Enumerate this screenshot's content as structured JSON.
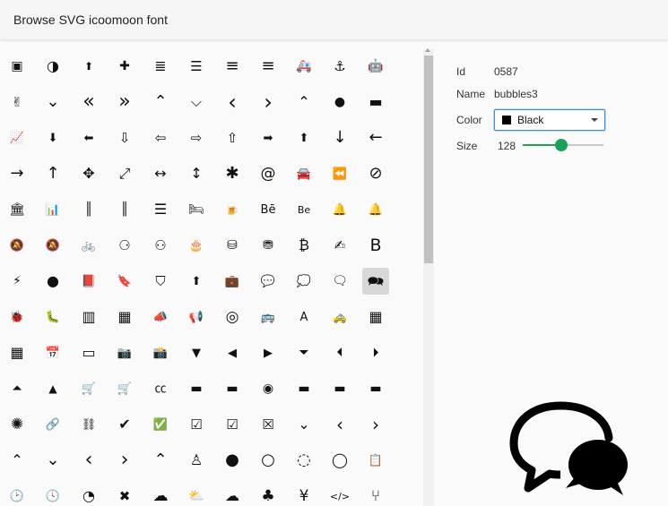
{
  "app": {
    "title": "Browse SVG icoomoon font"
  },
  "details": {
    "id_label": "Id",
    "id_value": "0587",
    "name_label": "Name",
    "name_value": "bubbles3",
    "color_label": "Color",
    "color_value": "Black",
    "color_hex": "#000000",
    "size_label": "Size",
    "size_value": "128",
    "size_fraction": 0.48
  },
  "icons": [
    [
      "address-book",
      "contrast",
      "arrow-up-circle",
      "first-aid",
      "align-center",
      "align-justify",
      "align-left",
      "align-right",
      "ambulance",
      "anchor",
      "android"
    ],
    [
      "angellist",
      "angle-double-down",
      "angle-double-left",
      "angle-double-right",
      "angle-double-up",
      "angle-down",
      "angle-left",
      "angle-right",
      "angle-up",
      "apple",
      "archive"
    ],
    [
      "area-chart",
      "arrow-circle-down",
      "arrow-circle-left",
      "arrow-circle-o-down",
      "arrow-circle-o-left",
      "arrow-circle-o-right",
      "arrow-circle-o-up",
      "arrow-circle-right",
      "arrow-circle-up",
      "arrow-down",
      "arrow-left"
    ],
    [
      "arrow-right",
      "arrow-up",
      "arrows",
      "arrows-alt",
      "arrows-h",
      "arrows-v",
      "asterisk",
      "at",
      "automobile",
      "backward",
      "ban"
    ],
    [
      "bank",
      "bar-chart",
      "barcode",
      "barcode-alt",
      "bars",
      "bed",
      "beer",
      "behance",
      "behance-square",
      "bell",
      "bell-o"
    ],
    [
      "bell-slash",
      "bell-slash-o",
      "bicycle",
      "binoculars",
      "binoculars-alt",
      "birthday-cake",
      "bitbucket",
      "bitbucket-square",
      "bitcoin",
      "bomb-alt",
      "bold"
    ],
    [
      "bolt",
      "bomb",
      "book",
      "bookmark",
      "bookmark-o",
      "box-in",
      "briefcase",
      "bubble",
      "bubble-o",
      "bubbles",
      "bubbles3"
    ],
    [
      "bug",
      "bug-alt",
      "building",
      "building-o",
      "bullhorn",
      "bullhorn-o",
      "bullseye",
      "bus",
      "cab-square",
      "cab",
      "calculator"
    ],
    [
      "calendar-grid",
      "calendar",
      "calendar-o",
      "camera",
      "camera-retro",
      "caret-down",
      "caret-left",
      "caret-right",
      "caret-square-down",
      "caret-square-left",
      "caret-square-right"
    ],
    [
      "caret-square-up",
      "caret-up",
      "cart-arrow-down",
      "cart-plus",
      "cc",
      "cc-amex",
      "cc-discover",
      "cc-mastercard",
      "cc-paypal",
      "cc-stripe",
      "cc-visa"
    ],
    [
      "certificate",
      "chain",
      "chain-broken",
      "check",
      "check-circle",
      "check-circle-o",
      "check-square",
      "check-square-o",
      "chevron-circle-down",
      "chevron-circle-left",
      "chevron-circle-right"
    ],
    [
      "chevron-circle-up",
      "chevron-down",
      "chevron-left",
      "chevron-right",
      "chevron-up",
      "child",
      "circle",
      "circle-o",
      "circle-o-notch",
      "circle-thin",
      "clipboard"
    ],
    [
      "clock",
      "clock-o",
      "clock-alt",
      "close",
      "cloud",
      "cloud-download",
      "cloud-upload",
      "club",
      "cny",
      "code",
      "code-fork"
    ]
  ]
}
